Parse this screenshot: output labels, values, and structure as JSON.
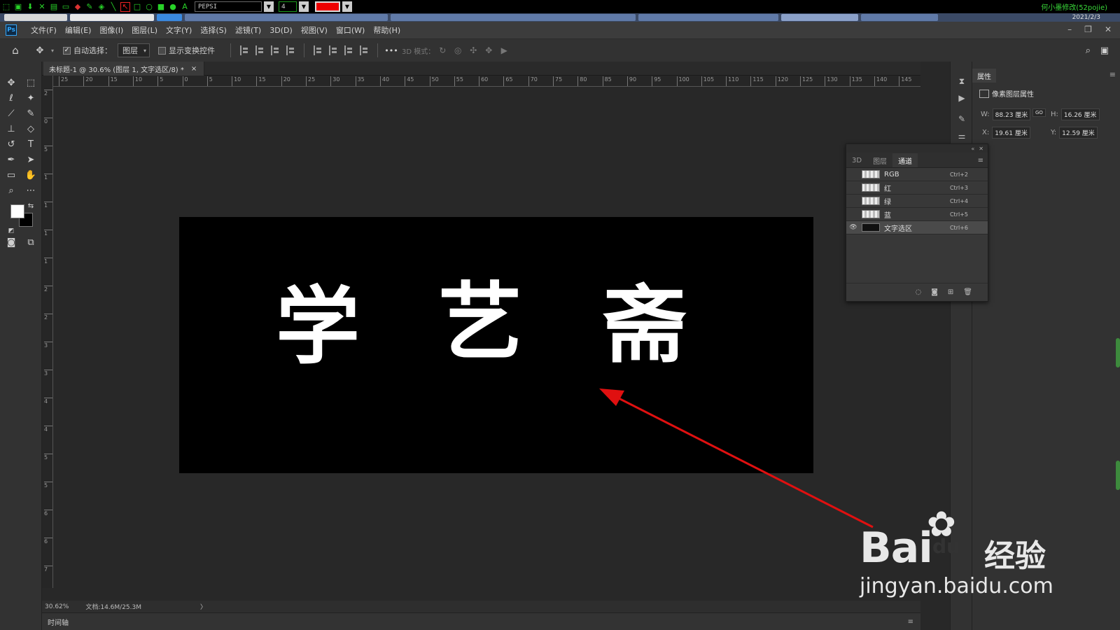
{
  "annot_toolbar": {
    "font": "PEPSI",
    "size": "4",
    "user_text": "何小墨修改(52pojie)",
    "date": "2021/2/3"
  },
  "menu": [
    "文件(F)",
    "编辑(E)",
    "图像(I)",
    "图层(L)",
    "文字(Y)",
    "选择(S)",
    "滤镜(T)",
    "3D(D)",
    "视图(V)",
    "窗口(W)",
    "帮助(H)"
  ],
  "options": {
    "auto_select_label": "自动选择：",
    "auto_select_value": "图层",
    "show_transform_label": "显示变换控件",
    "more": "•••",
    "mode_3d": "3D 模式："
  },
  "document": {
    "tab_title": "未标题-1 @ 30.6% (图层 1, 文字选区/8) *",
    "close": "×"
  },
  "canvas_text": {
    "chars": [
      "学",
      "艺",
      "斋"
    ]
  },
  "status": {
    "zoom": "30.62%",
    "doc_size": "文档:14.6M/25.3M",
    "more": "〉"
  },
  "timeline_label": "时间轴",
  "properties": {
    "tab": "属性",
    "type": "像素图层属性",
    "w_label": "W:",
    "w": "88.23 厘米",
    "link": "GO",
    "h_label": "H:",
    "h": "16.26 厘米",
    "x_label": "X:",
    "x": "19.61 厘米",
    "y_label": "Y:",
    "y": "12.59 厘米"
  },
  "channels_panel": {
    "tabs": [
      "3D",
      "图层",
      "通道"
    ],
    "active_tab": "通道",
    "rows": [
      {
        "name": "RGB",
        "shortcut": "Ctrl+2"
      },
      {
        "name": "红",
        "shortcut": "Ctrl+3"
      },
      {
        "name": "绿",
        "shortcut": "Ctrl+4"
      },
      {
        "name": "蓝",
        "shortcut": "Ctrl+5"
      },
      {
        "name": "文字选区",
        "shortcut": "Ctrl+6"
      }
    ]
  },
  "ruler_h": [
    "25",
    "20",
    "15",
    "10",
    "5",
    "0",
    "5",
    "10",
    "15",
    "20",
    "25",
    "30",
    "35",
    "40",
    "45",
    "50",
    "55",
    "60",
    "65",
    "70",
    "75",
    "80",
    "85",
    "90",
    "95",
    "100",
    "105",
    "110",
    "115",
    "120",
    "125",
    "130",
    "135",
    "140",
    "145"
  ],
  "ruler_v": [
    "2",
    "0",
    "5",
    "1",
    "1",
    "1",
    "1",
    "2",
    "2",
    "3",
    "3",
    "4",
    "4",
    "5",
    "5",
    "6",
    "6",
    "7"
  ],
  "watermark": {
    "brand_latin": "Bai",
    "brand_paw": "du",
    "brand_cn": "经验",
    "url": "jingyan.baidu.com"
  },
  "colors": {
    "accent_red": "#e01010",
    "fg_swatch": "#ffffff",
    "bg_swatch": "#000000"
  }
}
